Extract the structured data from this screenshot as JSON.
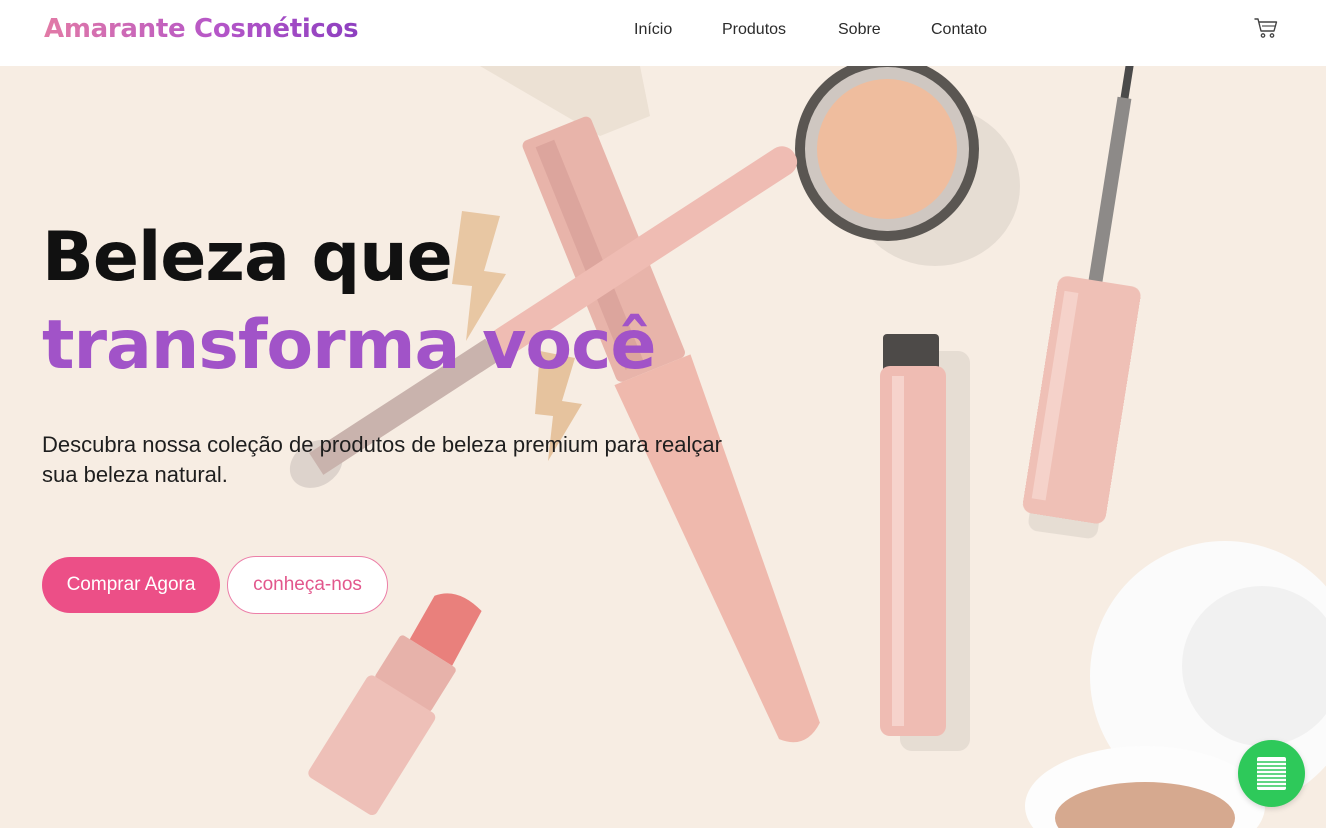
{
  "brand": {
    "name": "Amarante Cosméticos"
  },
  "nav": {
    "links": [
      {
        "label": "Início"
      },
      {
        "label": "Produtos"
      },
      {
        "label": "Sobre"
      },
      {
        "label": "Contato"
      }
    ],
    "cart_icon": "cart-icon"
  },
  "hero": {
    "headline_line1": "Beleza que",
    "headline_line2": "transforma você",
    "subtitle": "Descubra nossa coleção de produtos de beleza premium para realçar sua beleza natural.",
    "primary_cta": "Comprar Agora",
    "secondary_cta": "conheça-nos",
    "background_icon": "makeup-flatlay-image"
  },
  "floating_button": {
    "icon": "menu-lines-icon"
  },
  "colors": {
    "accent_purple": "#a153c8",
    "cta_pink": "#ec4f87",
    "hero_background": "#f7ede3",
    "fab_green": "#2ec95a"
  }
}
